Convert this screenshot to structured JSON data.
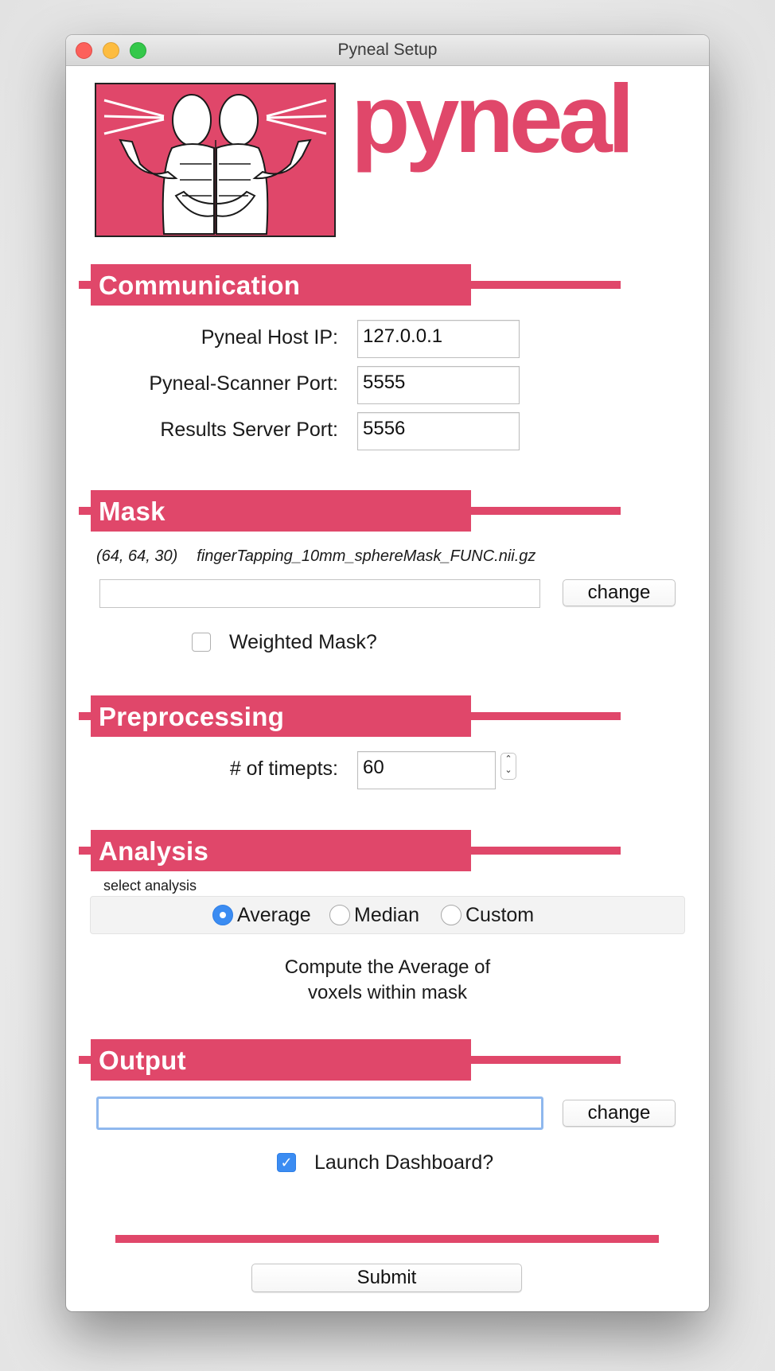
{
  "window": {
    "title": "Pyneal Setup"
  },
  "logo": {
    "text": "pyneal"
  },
  "colors": {
    "accent": "#e0476a",
    "focus": "#8fb8ee",
    "check": "#3b8cf2"
  },
  "communication": {
    "header": "Communication",
    "host_ip_label": "Pyneal Host IP:",
    "host_ip_value": "127.0.0.1",
    "scanner_port_label": "Pyneal-Scanner Port:",
    "scanner_port_value": "5555",
    "results_port_label": "Results Server Port:",
    "results_port_value": "5556"
  },
  "mask": {
    "header": "Mask",
    "dims": "(64, 64, 30)",
    "filename": "fingerTapping_10mm_sphereMask_FUNC.nii.gz",
    "path_value": "",
    "change_label": "change",
    "weighted_label": "Weighted Mask?",
    "weighted_checked": false
  },
  "preprocessing": {
    "header": "Preprocessing",
    "timepts_label": "# of timepts:",
    "timepts_value": "60"
  },
  "analysis": {
    "header": "Analysis",
    "select_label": "select analysis",
    "options": [
      "Average",
      "Median",
      "Custom"
    ],
    "selected": "Average",
    "description_line1": "Compute the Average of",
    "description_line2": "voxels within mask"
  },
  "output": {
    "header": "Output",
    "path_value": "",
    "change_label": "change",
    "dashboard_label": "Launch Dashboard?",
    "dashboard_checked": true
  },
  "submit": {
    "label": "Submit"
  }
}
